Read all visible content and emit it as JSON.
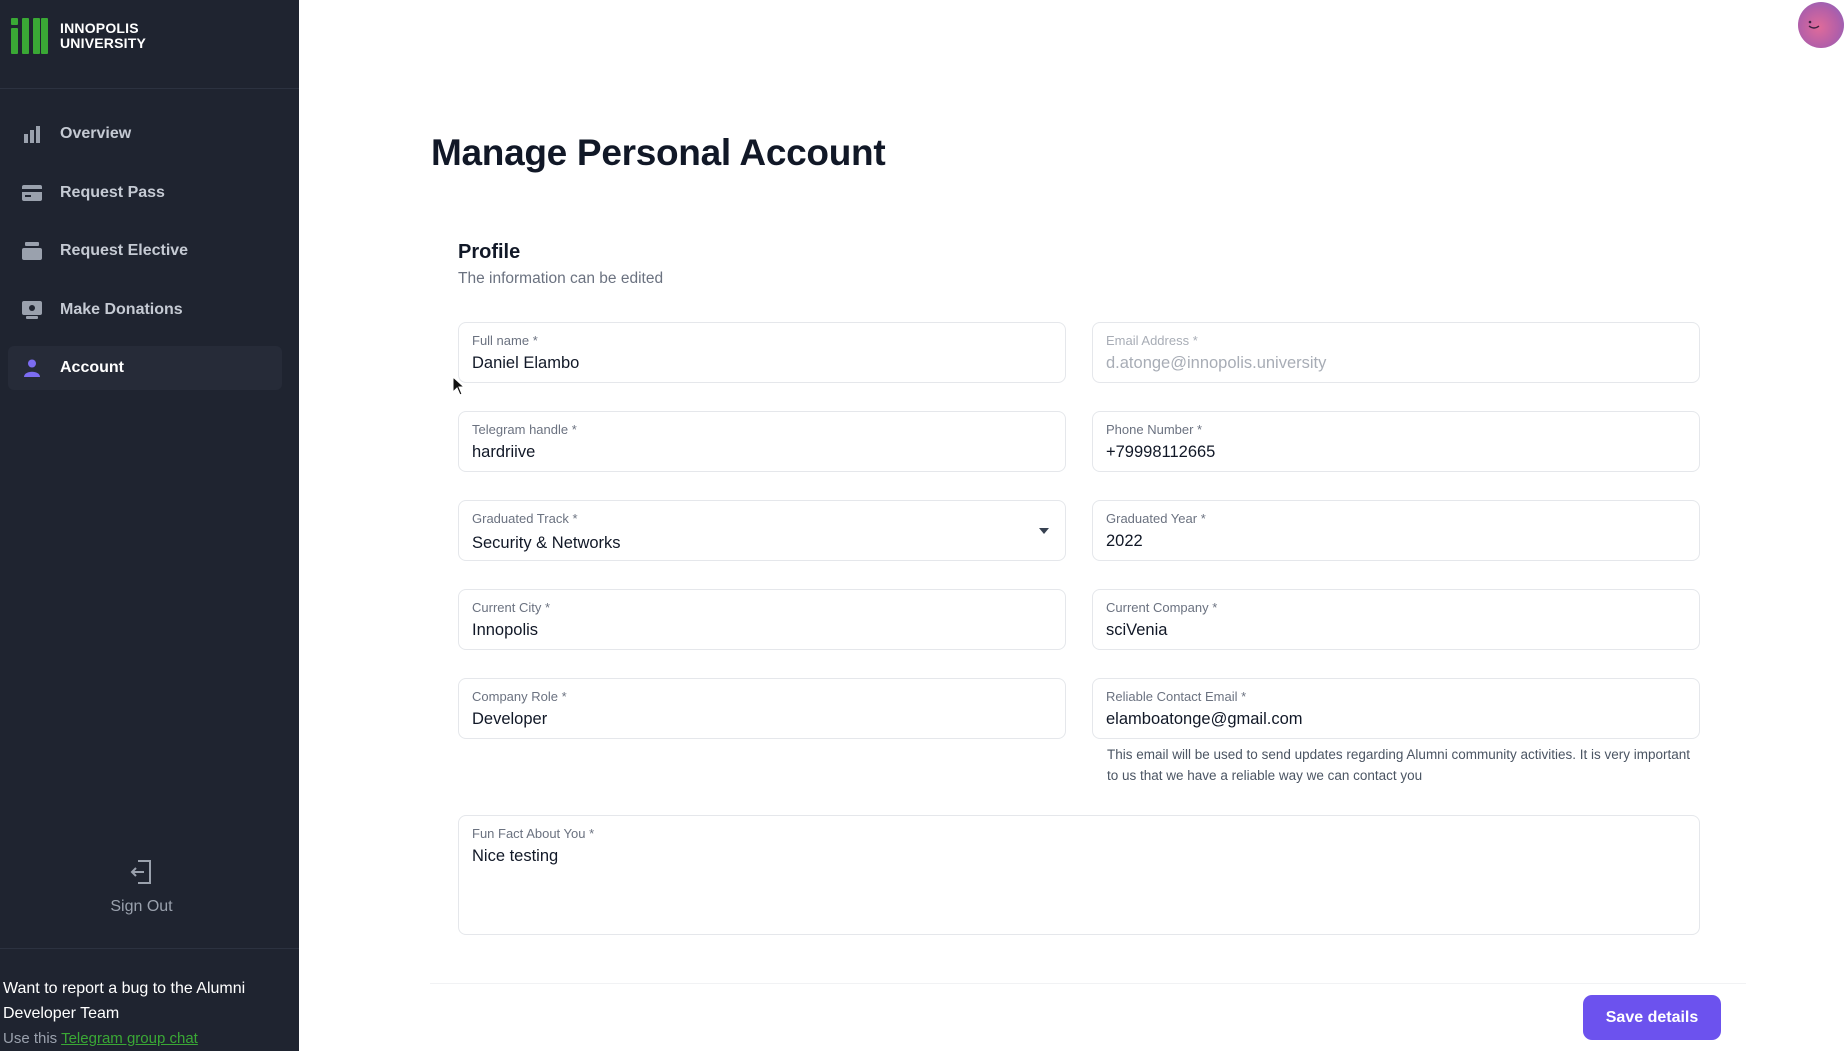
{
  "brand": {
    "line1": "INNOPOLIS",
    "line2": "UNIVERSITY",
    "color": "#3aa835"
  },
  "sidebar": {
    "items": [
      {
        "label": "Overview",
        "icon": "bar-chart-icon"
      },
      {
        "label": "Request Pass",
        "icon": "pass-card-icon"
      },
      {
        "label": "Request Elective",
        "icon": "elective-box-icon"
      },
      {
        "label": "Make Donations",
        "icon": "donation-icon"
      },
      {
        "label": "Account",
        "icon": "person-icon",
        "active": true
      }
    ],
    "sign_out": "Sign Out",
    "bug_report": {
      "text": "Want to report a bug to the Alumni Developer Team",
      "use_this": "Use this",
      "link": "Telegram group chat"
    }
  },
  "page": {
    "title": "Manage Personal Account"
  },
  "profile": {
    "title": "Profile",
    "subtitle": "The information can be edited",
    "full_name": {
      "label": "Full name *",
      "value": "Daniel Elambo"
    },
    "email": {
      "label": "Email Address *",
      "value": "d.atonge@innopolis.university"
    },
    "telegram": {
      "label": "Telegram handle *",
      "value": "hardriive"
    },
    "phone": {
      "label": "Phone Number *",
      "value": "+79998112665"
    },
    "track": {
      "label": "Graduated Track *",
      "value": "Security & Networks"
    },
    "year": {
      "label": "Graduated Year *",
      "value": "2022"
    },
    "city": {
      "label": "Current City *",
      "value": "Innopolis"
    },
    "company": {
      "label": "Current Company *",
      "value": "sciVenia"
    },
    "role": {
      "label": "Company Role *",
      "value": "Developer"
    },
    "reliable_email": {
      "label": "Reliable Contact Email *",
      "value": "elamboatonge@gmail.com",
      "helper": "This email will be used to send updates regarding Alumni community activities. It is very important to us that we have a reliable way we can contact you"
    },
    "fun_fact": {
      "label": "Fun Fact About You *",
      "value": "Nice testing"
    },
    "save_label": "Save details"
  },
  "colors": {
    "sidebar_bg": "#1f2430",
    "accent": "#6c52ee"
  }
}
